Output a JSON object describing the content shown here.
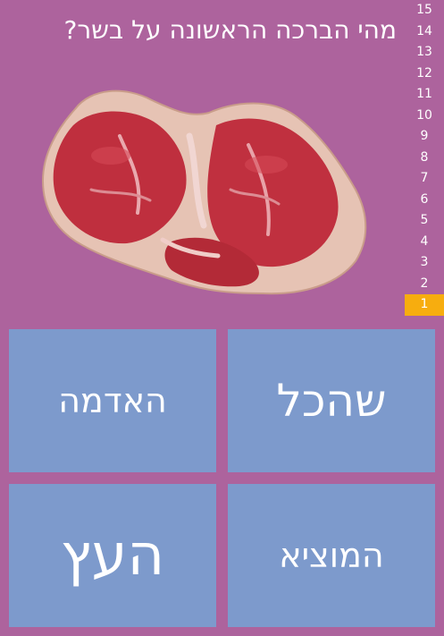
{
  "question": "מהי הברכה הראשונה על בשר?",
  "image": {
    "icon": "raw-meat-steak-image"
  },
  "levels": [
    {
      "num": "15",
      "current": false
    },
    {
      "num": "14",
      "current": false
    },
    {
      "num": "13",
      "current": false
    },
    {
      "num": "12",
      "current": false
    },
    {
      "num": "11",
      "current": false
    },
    {
      "num": "10",
      "current": false
    },
    {
      "num": "9",
      "current": false
    },
    {
      "num": "8",
      "current": false
    },
    {
      "num": "7",
      "current": false
    },
    {
      "num": "6",
      "current": false
    },
    {
      "num": "5",
      "current": false
    },
    {
      "num": "4",
      "current": false
    },
    {
      "num": "3",
      "current": false
    },
    {
      "num": "2",
      "current": false
    },
    {
      "num": "1",
      "current": true
    }
  ],
  "answers": [
    {
      "label": "האדמה"
    },
    {
      "label": "שהכל"
    },
    {
      "label": "העץ"
    },
    {
      "label": "המוציא"
    }
  ],
  "colors": {
    "background": "#ad639d",
    "answer_tile": "#7d9acc",
    "current_level": "#f7ad0f",
    "text": "#ffffff"
  }
}
